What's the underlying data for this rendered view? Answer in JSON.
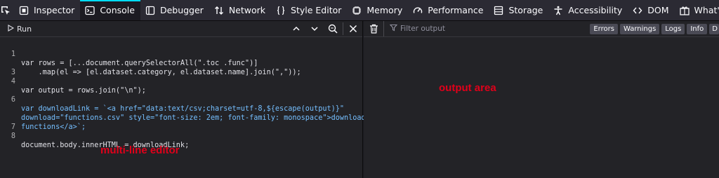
{
  "toolbar": {
    "tabs": [
      {
        "label": "Inspector",
        "icon": "inspector-icon"
      },
      {
        "label": "Console",
        "icon": "console-icon",
        "selected": true
      },
      {
        "label": "Debugger",
        "icon": "debugger-icon"
      },
      {
        "label": "Network",
        "icon": "network-icon"
      },
      {
        "label": "Style Editor",
        "icon": "style-editor-icon"
      },
      {
        "label": "Memory",
        "icon": "memory-icon"
      },
      {
        "label": "Performance",
        "icon": "performance-icon"
      },
      {
        "label": "Storage",
        "icon": "storage-icon"
      },
      {
        "label": "Accessibility",
        "icon": "accessibility-icon"
      },
      {
        "label": "DOM",
        "icon": "dom-icon"
      },
      {
        "label": "What's New",
        "icon": "whats-new-icon"
      }
    ]
  },
  "editor": {
    "run_label": "Run",
    "line_numbers": [
      "1",
      "",
      "3",
      "4",
      "",
      "6",
      "",
      "",
      "7",
      "8"
    ],
    "lines": [
      "var rows = [...document.querySelectorAll(\".toc .func\")]",
      "    .map(el => [el.dataset.category, el.dataset.name].join(\",\"));",
      "",
      "var output = rows.join(\"\\n\");",
      "",
      "var downloadLink = `<a href=\"data:text/csv;charset=utf-8,${escape(output)}\"",
      "download=\"functions.csv\" style=\"font-size: 2em; font-family: monospace\">download",
      "functions</a>`;",
      "",
      "document.body.innerHTML = downloadLink;"
    ],
    "annotation": "multi-line editor"
  },
  "output": {
    "filter_placeholder": "Filter output",
    "filters": [
      "Errors",
      "Warnings",
      "Logs",
      "Info",
      "D"
    ],
    "annotation": "output area"
  },
  "colors": {
    "accent": "#00ddff",
    "annotation": "#e0001a",
    "keyword": "#86de74",
    "variable": "#75bfff"
  }
}
